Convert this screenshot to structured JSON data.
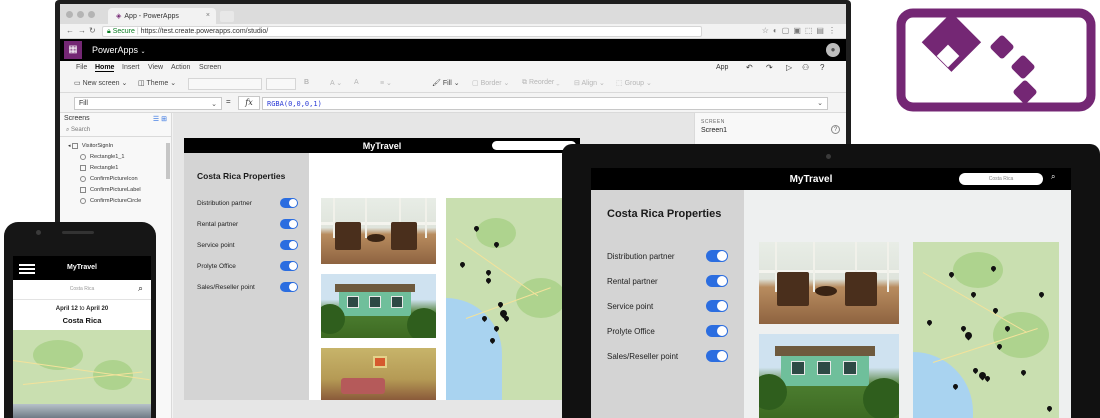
{
  "browser": {
    "tab_title": "App - PowerApps",
    "url_secure": "Secure",
    "url": "https://test.create.powerapps.com/studio/"
  },
  "studio": {
    "brand": "PowerApps",
    "menu_tabs": [
      "File",
      "Home",
      "Insert",
      "View",
      "Action",
      "Screen"
    ],
    "active_tab": "Home",
    "right_label": "App",
    "ribbon": {
      "new_screen": "New screen",
      "theme": "Theme",
      "bold": "B",
      "fill": "Fill",
      "border": "Border",
      "reorder": "Reorder",
      "align": "Align",
      "group": "Group"
    },
    "formula": {
      "property": "Fill",
      "equals": "=",
      "fx": "fx",
      "expression": "RGBA(0,0,0,1)"
    },
    "screens_pane": {
      "title": "Screens",
      "search_placeholder": "Search",
      "items": [
        {
          "label": "VisitorSignIn",
          "level": 0
        },
        {
          "label": "Rectangle1_1",
          "level": 1
        },
        {
          "label": "Rectangle1",
          "level": 1
        },
        {
          "label": "ConfirmPictureIcon",
          "level": 1
        },
        {
          "label": "ConfirmPictureLabel",
          "level": 1
        },
        {
          "label": "ConfirmPictureCircle",
          "level": 1
        }
      ]
    },
    "properties_pane": {
      "section": "SCREEN",
      "value": "Screen1",
      "help": "?"
    }
  },
  "app": {
    "title": "MyTravel",
    "heading": "Costa Rica Properties",
    "search_value": "Costa Rica",
    "options": [
      {
        "label": "Distribution partner",
        "on": true
      },
      {
        "label": "Rental partner",
        "on": true
      },
      {
        "label": "Service point",
        "on": true
      },
      {
        "label": "Prolyte Office",
        "on": true
      },
      {
        "label": "Sales/Reseller point",
        "on": true
      }
    ]
  },
  "phone": {
    "title": "MyTravel",
    "search_value": "Costa Rica",
    "date_from": "April 12",
    "date_to_word": "to",
    "date_to": "April 20",
    "city": "Costa Rica"
  },
  "colors": {
    "brand": "#742774",
    "toggle": "#2b6de0",
    "app_side": "#d4d4d4"
  }
}
